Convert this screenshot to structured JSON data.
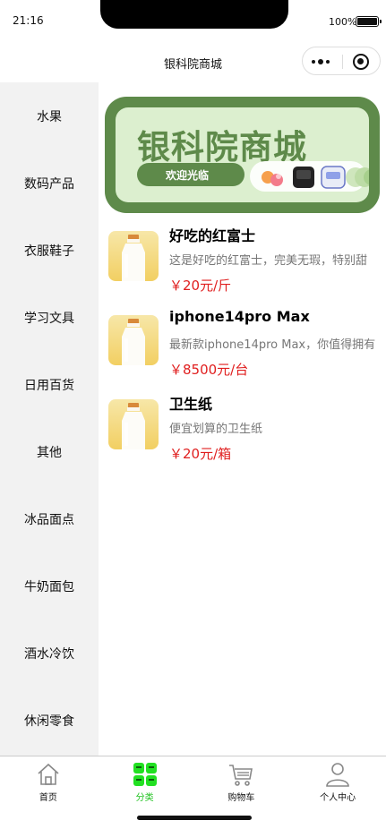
{
  "status_bar": {
    "time": "21:16",
    "battery": "100%"
  },
  "nav": {
    "title": "银科院商城"
  },
  "sidebar": {
    "items": [
      {
        "label": "水果"
      },
      {
        "label": "数码产品"
      },
      {
        "label": "衣服鞋子"
      },
      {
        "label": "学习文具"
      },
      {
        "label": "日用百货"
      },
      {
        "label": "其他"
      },
      {
        "label": "冰品面点"
      },
      {
        "label": "牛奶面包"
      },
      {
        "label": "酒水冷饮"
      },
      {
        "label": "休闲零食"
      }
    ]
  },
  "banner": {
    "title": "银科院商城",
    "subtitle": "欢迎光临"
  },
  "products": [
    {
      "name": "好吃的红富士",
      "desc": "这是好吃的红富士，完美无瑕，特别甜",
      "price": "￥20元/斤"
    },
    {
      "name": "iphone14pro Max",
      "desc": "最新款iphone14pro Max，你值得拥有",
      "price": "￥8500元/台"
    },
    {
      "name": "卫生纸",
      "desc": "便宜划算的卫生纸",
      "price": "￥20元/箱"
    }
  ],
  "tab_bar": {
    "tabs": [
      {
        "label": "首页",
        "icon": "home-icon"
      },
      {
        "label": "分类",
        "icon": "grid-icon"
      },
      {
        "label": "购物车",
        "icon": "cart-icon"
      },
      {
        "label": "个人中心",
        "icon": "user-icon"
      }
    ],
    "active_color": "#22c322"
  }
}
